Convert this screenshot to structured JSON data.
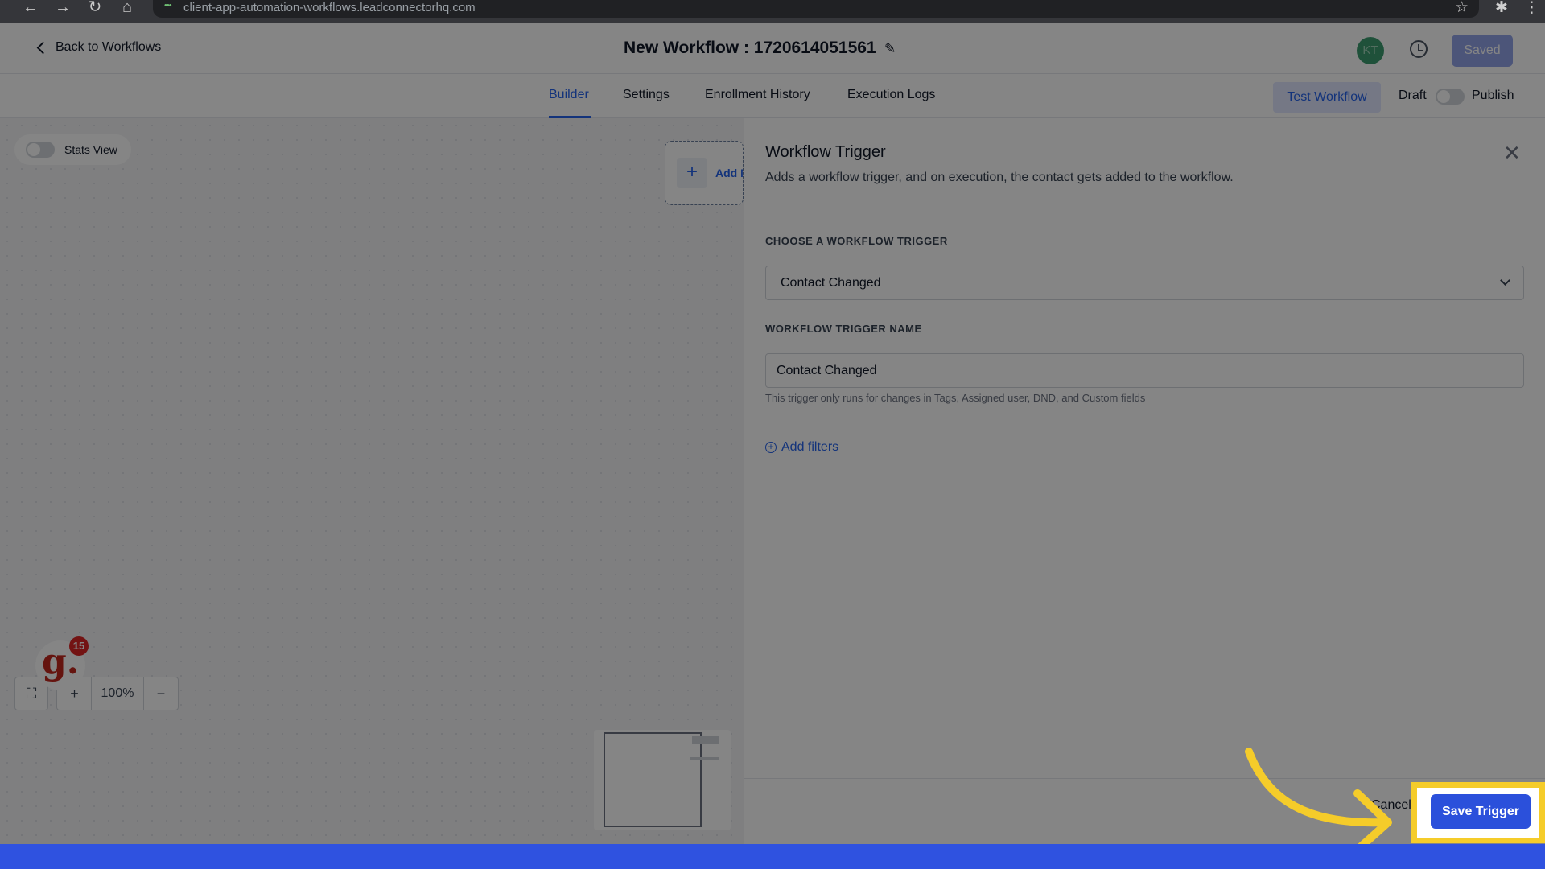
{
  "browser": {
    "url": "client-app-automation-workflows.leadconnectorhq.com",
    "back_icon": "←",
    "forward_icon": "→",
    "reload_icon": "↻",
    "home_icon": "⌂",
    "star_icon": "☆",
    "puzzle_icon": "✱",
    "menu_icon": "⋮"
  },
  "header": {
    "back_label": "Back to Workflows",
    "title": "New Workflow : 1720614051561",
    "edit_icon": "✎",
    "avatar_initials": "KT",
    "saved_label": "Saved"
  },
  "tabs": {
    "items": [
      {
        "label": "Builder",
        "active": true
      },
      {
        "label": "Settings",
        "active": false
      },
      {
        "label": "Enrollment History",
        "active": false
      },
      {
        "label": "Execution Logs",
        "active": false
      }
    ],
    "test_workflow_label": "Test Workflow",
    "draft_label": "Draft",
    "publish_label": "Publish"
  },
  "canvas": {
    "stats_view_label": "Stats View",
    "add_trigger_text": "Add New Trigger",
    "plus_icon": "+",
    "zoom_level": "100%",
    "zoom_in_icon": "+",
    "zoom_out_icon": "−",
    "fit_icon": "⛶",
    "badge_letter": "g.",
    "badge_count": "15"
  },
  "panel": {
    "title": "Workflow Trigger",
    "subtitle": "Adds a workflow trigger, and on execution, the contact gets added to the workflow.",
    "close_icon": "✕",
    "choose_label": "CHOOSE A WORKFLOW TRIGGER",
    "selected_trigger": "Contact Changed",
    "name_label": "WORKFLOW TRIGGER NAME",
    "name_value": "Contact Changed",
    "help_text": "This trigger only runs for changes in Tags, Assigned user, DND, and Custom fields",
    "add_filters_label": "Add filters",
    "cancel_label": "Cancel",
    "save_label": "Save Trigger"
  },
  "colors": {
    "accent": "#2563eb",
    "highlight": "#f5cc2a",
    "bottom_bar": "#2f52e0"
  }
}
